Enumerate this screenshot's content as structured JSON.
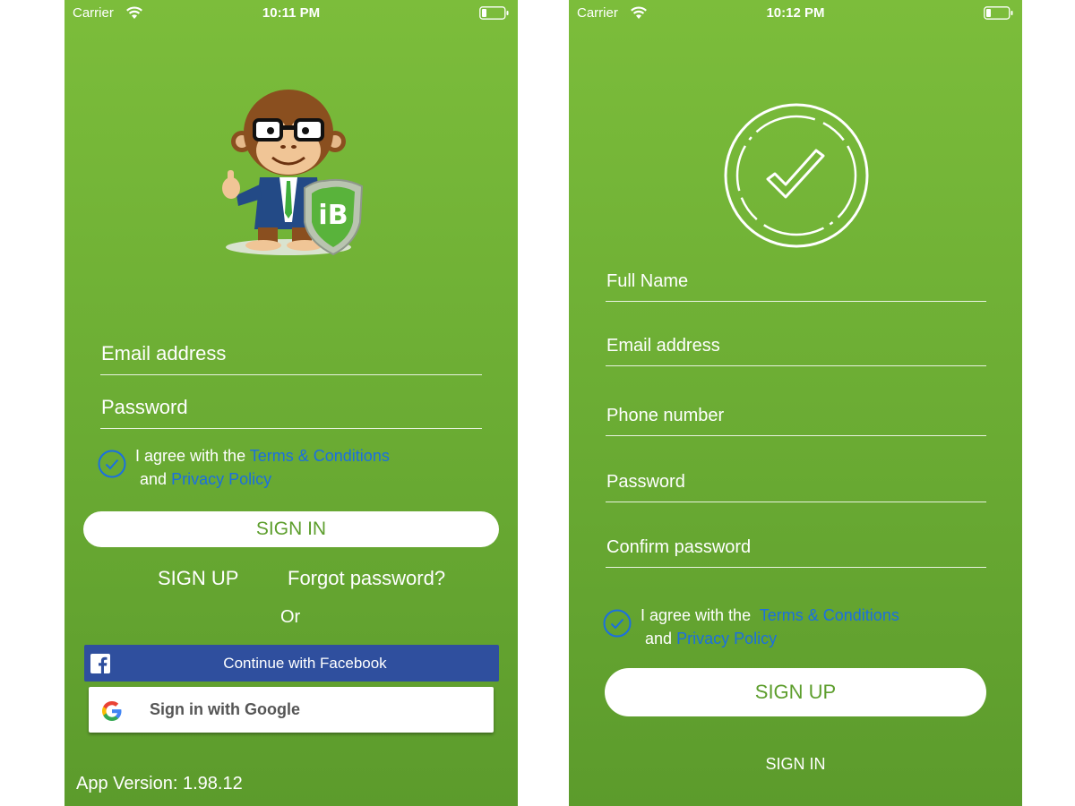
{
  "left": {
    "status": {
      "carrier": "Carrier",
      "time": "10:11 PM"
    },
    "email_placeholder": "Email address",
    "password_placeholder": "Password",
    "agree": {
      "prefix": "I agree with the",
      "terms_link": "Terms & Conditions",
      "and": "and",
      "privacy_link": "Privacy Policy"
    },
    "sign_in_button": "SIGN IN",
    "sign_up_link": "SIGN UP",
    "forgot_link": "Forgot password?",
    "or_text": "Or",
    "facebook_button": "Continue with Facebook",
    "google_button": "Sign in with Google",
    "app_version": "App Version: 1.98.12",
    "logo_text": "iB"
  },
  "right": {
    "status": {
      "carrier": "Carrier",
      "time": "10:12 PM"
    },
    "full_name_placeholder": "Full Name",
    "email_placeholder": "Email address",
    "phone_placeholder": "Phone number",
    "password_placeholder": "Password",
    "confirm_password_placeholder": "Confirm password",
    "agree": {
      "prefix": "I agree with the",
      "terms_link": "Terms & Conditions",
      "and": "and",
      "privacy_link": "Privacy Policy"
    },
    "sign_up_button": "SIGN UP",
    "sign_in_link": "SIGN IN"
  },
  "icons": {
    "wifi": "wifi-icon",
    "battery": "battery-icon",
    "check": "checkmark-circle-icon",
    "facebook": "facebook-icon",
    "google": "google-icon",
    "mascot": "monkey-mascot-with-shield",
    "success": "success-check-circle-icon"
  },
  "colors": {
    "background_top": "#7cbd3b",
    "background_bottom": "#5c9b2c",
    "link_blue": "#1b6fe0",
    "facebook_blue": "#2f4f9e",
    "button_text_green": "#5d9e2d"
  }
}
